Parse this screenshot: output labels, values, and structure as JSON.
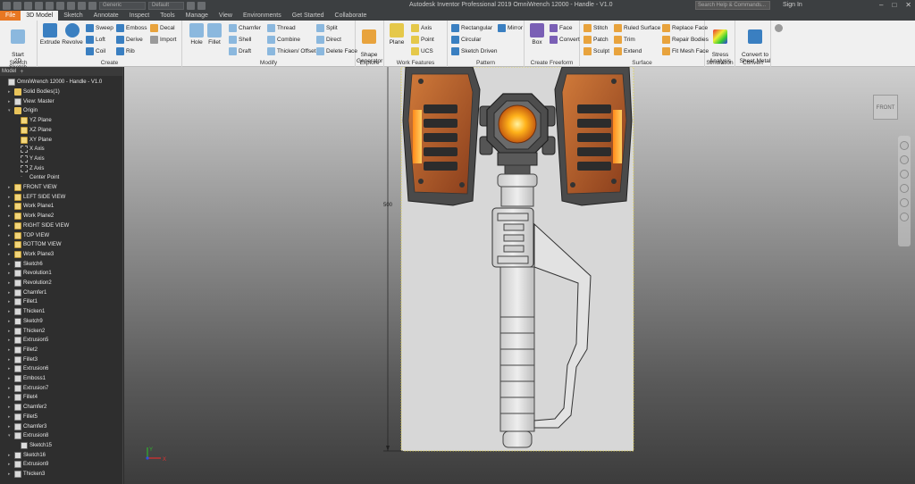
{
  "titlebar": {
    "app_title": "Autodesk Inventor Professional 2019   OmniWrench 12000 - Handle - V1.0",
    "material_select": "Generic",
    "appearance_select": "Default",
    "search_placeholder": "Search Help & Commands...",
    "signin_label": "Sign In",
    "minimize": "–",
    "maximize": "□",
    "close": "✕"
  },
  "tabs": [
    "File",
    "3D Model",
    "Sketch",
    "Annotate",
    "Inspect",
    "Tools",
    "Manage",
    "View",
    "Environments",
    "Get Started",
    "Collaborate"
  ],
  "ribbon": {
    "sketch": {
      "label": "Sketch",
      "start": "Start\n2D Sketch"
    },
    "create": {
      "label": "Create",
      "extrude": "Extrude",
      "revolve": "Revolve",
      "sweep": "Sweep",
      "loft": "Loft",
      "coil": "Coil",
      "emboss": "Emboss",
      "derive": "Derive",
      "rib": "Rib",
      "decal": "Decal",
      "import": "Import"
    },
    "modify": {
      "label": "Modify",
      "hole": "Hole",
      "fillet": "Fillet",
      "chamfer": "Chamfer",
      "shell": "Shell",
      "draft": "Draft",
      "thread": "Thread",
      "combine": "Combine",
      "thicken": "Thicken/ Offset",
      "split": "Split",
      "direct": "Direct",
      "delete_face": "Delete Face"
    },
    "explore": {
      "label": "Explore",
      "shape_generator": "Shape\nGenerator"
    },
    "work_features": {
      "label": "Work Features",
      "plane": "Plane",
      "axis": "Axis",
      "point": "Point",
      "ucs": "UCS"
    },
    "pattern": {
      "label": "Pattern",
      "rectangular": "Rectangular",
      "circular": "Circular",
      "sketch_driven": "Sketch Driven",
      "mirror": "Mirror"
    },
    "create_freeform": {
      "label": "Create Freeform",
      "box": "Box",
      "face": "Face",
      "convert": "Convert"
    },
    "surface": {
      "label": "Surface",
      "stitch": "Stitch",
      "patch": "Patch",
      "sculpt": "Sculpt",
      "ruled_surface": "Ruled Surface",
      "trim": "Trim",
      "extend": "Extend",
      "replace_face": "Replace Face",
      "repair_bodies": "Repair Bodies",
      "fit_mesh_face": "Fit Mesh Face"
    },
    "simulation": {
      "label": "Simulation",
      "stress_analysis": "Stress\nAnalysis"
    },
    "convert": {
      "label": "Convert",
      "convert_sheet_metal": "Convert to\nSheet Metal"
    }
  },
  "browser": {
    "tab_label": "Model",
    "items": [
      {
        "label": "OmniWrench 12000 - Handle - V1.0",
        "icon": "part-icon",
        "indent": 0,
        "arrow": ""
      },
      {
        "label": "Solid Bodies(1)",
        "icon": "folder-icon",
        "indent": 1,
        "arrow": "▸"
      },
      {
        "label": "View: Master",
        "icon": "view-icon",
        "indent": 1,
        "arrow": "▸"
      },
      {
        "label": "Origin",
        "icon": "folder-icon",
        "indent": 1,
        "arrow": "▾"
      },
      {
        "label": "YZ Plane",
        "icon": "plane-icon",
        "indent": 2,
        "arrow": ""
      },
      {
        "label": "XZ Plane",
        "icon": "plane-icon",
        "indent": 2,
        "arrow": ""
      },
      {
        "label": "XY Plane",
        "icon": "plane-icon",
        "indent": 2,
        "arrow": ""
      },
      {
        "label": "X Axis",
        "icon": "axis-icon",
        "indent": 2,
        "arrow": ""
      },
      {
        "label": "Y Axis",
        "icon": "axis-icon",
        "indent": 2,
        "arrow": ""
      },
      {
        "label": "Z Axis",
        "icon": "axis-icon",
        "indent": 2,
        "arrow": ""
      },
      {
        "label": "Center Point",
        "icon": "point-icon",
        "indent": 2,
        "arrow": ""
      },
      {
        "label": "FRONT VIEW",
        "icon": "plane-icon",
        "indent": 1,
        "arrow": "▸"
      },
      {
        "label": "LEFT SIDE VIEW",
        "icon": "plane-icon",
        "indent": 1,
        "arrow": "▸"
      },
      {
        "label": "Work Plane1",
        "icon": "plane-icon",
        "indent": 1,
        "arrow": "▸"
      },
      {
        "label": "Work Plane2",
        "icon": "plane-icon",
        "indent": 1,
        "arrow": "▸"
      },
      {
        "label": "RIGHT SIDE VIEW",
        "icon": "plane-icon",
        "indent": 1,
        "arrow": "▸"
      },
      {
        "label": "TOP VIEW",
        "icon": "plane-icon",
        "indent": 1,
        "arrow": "▸"
      },
      {
        "label": "BOTTOM VIEW",
        "icon": "plane-icon",
        "indent": 1,
        "arrow": "▸"
      },
      {
        "label": "Work Plane3",
        "icon": "plane-icon",
        "indent": 1,
        "arrow": "▸"
      },
      {
        "label": "Sketch6",
        "icon": "sketch-icon",
        "indent": 1,
        "arrow": "▸"
      },
      {
        "label": "Revolution1",
        "icon": "revolve-icon",
        "indent": 1,
        "arrow": "▸"
      },
      {
        "label": "Revolution2",
        "icon": "revolve-icon",
        "indent": 1,
        "arrow": "▸"
      },
      {
        "label": "Chamfer1",
        "icon": "chamfer-icon",
        "indent": 1,
        "arrow": "▸"
      },
      {
        "label": "Fillet1",
        "icon": "fillet-icon",
        "indent": 1,
        "arrow": "▸"
      },
      {
        "label": "Thicken1",
        "icon": "thicken-icon",
        "indent": 1,
        "arrow": "▸"
      },
      {
        "label": "Sketch9",
        "icon": "sketch-icon",
        "indent": 1,
        "arrow": "▸"
      },
      {
        "label": "Thicken2",
        "icon": "thicken-icon",
        "indent": 1,
        "arrow": "▸"
      },
      {
        "label": "Extrusion5",
        "icon": "extrude-icon",
        "indent": 1,
        "arrow": "▸"
      },
      {
        "label": "Fillet2",
        "icon": "fillet-icon",
        "indent": 1,
        "arrow": "▸"
      },
      {
        "label": "Fillet3",
        "icon": "fillet-icon",
        "indent": 1,
        "arrow": "▸"
      },
      {
        "label": "Extrusion6",
        "icon": "extrude-icon",
        "indent": 1,
        "arrow": "▸"
      },
      {
        "label": "Emboss1",
        "icon": "emboss-icon",
        "indent": 1,
        "arrow": "▸"
      },
      {
        "label": "Extrusion7",
        "icon": "extrude-icon",
        "indent": 1,
        "arrow": "▸"
      },
      {
        "label": "Fillet4",
        "icon": "fillet-icon",
        "indent": 1,
        "arrow": "▸"
      },
      {
        "label": "Chamfer2",
        "icon": "chamfer-icon",
        "indent": 1,
        "arrow": "▸"
      },
      {
        "label": "Fillet5",
        "icon": "fillet-icon",
        "indent": 1,
        "arrow": "▸"
      },
      {
        "label": "Chamfer3",
        "icon": "chamfer-icon",
        "indent": 1,
        "arrow": "▸"
      },
      {
        "label": "Extrusion8",
        "icon": "extrude-icon",
        "indent": 1,
        "arrow": "▾"
      },
      {
        "label": "Sketch15",
        "icon": "sketch-icon",
        "indent": 2,
        "arrow": ""
      },
      {
        "label": "Sketch16",
        "icon": "sketch-icon",
        "indent": 1,
        "arrow": "▸"
      },
      {
        "label": "Extrusion9",
        "icon": "extrude-icon",
        "indent": 1,
        "arrow": "▸"
      },
      {
        "label": "Thicken3",
        "icon": "thicken-icon",
        "indent": 1,
        "arrow": "▸"
      }
    ]
  },
  "viewport": {
    "viewcube_label": "FRONT",
    "dimension_value": "500",
    "triad_x": "X",
    "triad_y": "Y"
  },
  "colors": {
    "file_tab": "#e87722",
    "model_orange": "#c8602a",
    "glow": "#ffb21a",
    "handle_grey": "#d8d8d8",
    "viewport_top": "#cfcfcf",
    "viewport_bottom": "#3c3c3c"
  }
}
